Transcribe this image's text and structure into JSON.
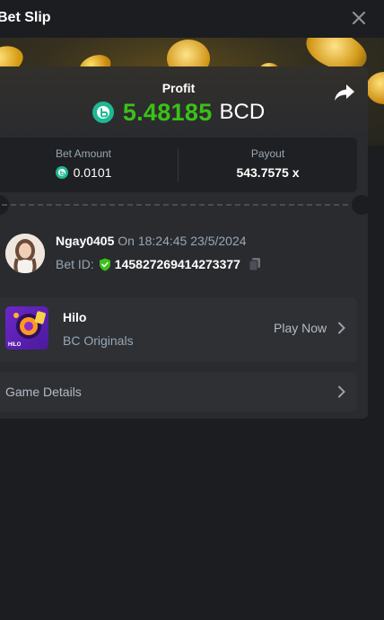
{
  "header": {
    "title": "Bet Slip",
    "close_icon": "close-icon"
  },
  "profit": {
    "label": "Profit",
    "coin_icon": "bc-coin-icon",
    "amount": "5.48185",
    "currency": "BCD",
    "share_icon": "share-icon",
    "amount_color": "#3bc117"
  },
  "stats": {
    "bet_amount_label": "Bet Amount",
    "bet_amount_value": "0.0101",
    "payout_label": "Payout",
    "payout_value": "543.7575 x"
  },
  "bet": {
    "username": "Ngay0405",
    "time_text": "On 18:24:45 23/5/2024",
    "bet_id_label": "Bet ID:",
    "bet_id_value": "145827269414273377",
    "verified_icon": "verified-shield-icon",
    "copy_icon": "copy-icon"
  },
  "game": {
    "name": "Hilo",
    "provider": "BC Originals",
    "thumb_text": "HILO",
    "play_now_label": "Play Now"
  },
  "details": {
    "label": "Game Details"
  },
  "colors": {
    "background": "#1c1d20",
    "card": "#2a2b2f",
    "accent_green": "#3bc117",
    "muted_text": "#98a7b5"
  }
}
